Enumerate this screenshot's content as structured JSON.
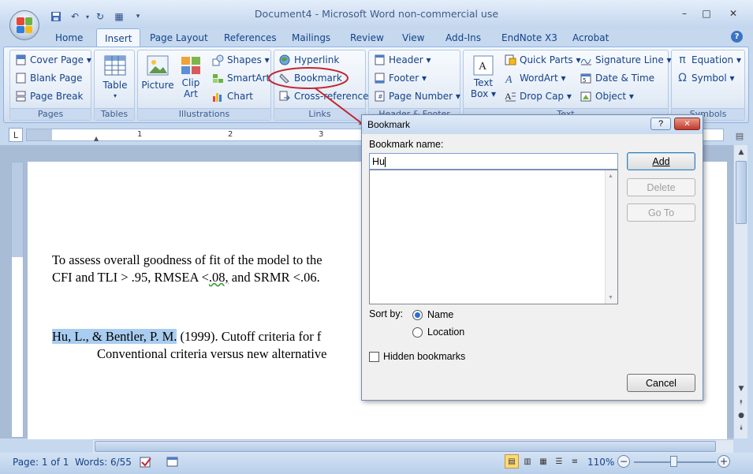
{
  "window": {
    "title": "Document4 - Microsoft Word non-commercial use",
    "minimize": "–",
    "maximize": "□",
    "close": "✕"
  },
  "qat": {
    "save": "💾",
    "undo": "↶",
    "redo": "↻",
    "grid": "▦",
    "more": "▾"
  },
  "tabs": [
    "Home",
    "Insert",
    "Page Layout",
    "References",
    "Mailings",
    "Review",
    "View",
    "Add-Ins",
    "EndNote X3",
    "Acrobat"
  ],
  "help": "?",
  "ribbon": {
    "pages": {
      "label": "Pages",
      "cover": "Cover Page ▾",
      "blank": "Blank Page",
      "break": "Page Break"
    },
    "tables": {
      "label": "Tables",
      "table": "Table",
      "arrow": "▾"
    },
    "illustrations": {
      "label": "Illustrations",
      "picture": "Picture",
      "clipart1": "Clip",
      "clipart2": "Art",
      "shapes": "Shapes ▾",
      "smartart": "SmartArt",
      "chart": "Chart"
    },
    "links": {
      "label": "Links",
      "hyperlink": "Hyperlink",
      "bookmark": "Bookmark",
      "crossref": "Cross-reference"
    },
    "header": {
      "label": "Header & Footer",
      "header": "Header ▾",
      "footer": "Footer ▾",
      "pagenum": "Page Number ▾"
    },
    "text": {
      "label": "Text",
      "textbox1": "Text",
      "textbox2": "Box ▾",
      "quickparts": "Quick Parts ▾",
      "wordart": "WordArt ▾",
      "dropcap": "Drop Cap ▾",
      "sigline": "Signature Line ▾",
      "datetime": "Date & Time",
      "object": "Object ▾"
    },
    "symbols": {
      "label": "Symbols",
      "equation": "Equation ▾",
      "symbol": "Symbol ▾"
    }
  },
  "ruler": {
    "marks": [
      "1",
      "2",
      "3"
    ]
  },
  "document": {
    "line1": "To assess overall goodness of fit of the model to the",
    "line2a": "CFI and TLI > .95, RMSEA <",
    "line2b": ".08,",
    "line2c": " and SRMR <.06.",
    "ref_highlight": "Hu, L., & Bentler, P. M.",
    "ref_rest": " (1999). Cutoff criteria for f",
    "ref_line2": "Conventional criteria versus new alternative"
  },
  "dialog": {
    "title": "Bookmark",
    "help": "?",
    "close": "✕",
    "name_label": "Bookmark name:",
    "name_value": "Hu",
    "add": "Add",
    "delete": "Delete",
    "goto": "Go To",
    "sort_label": "Sort by:",
    "sort_name": "Name",
    "sort_location": "Location",
    "hidden": "Hidden bookmarks",
    "cancel": "Cancel"
  },
  "status": {
    "page": "Page: 1 of 1",
    "words": "Words: 6/55",
    "zoom": "110%"
  }
}
